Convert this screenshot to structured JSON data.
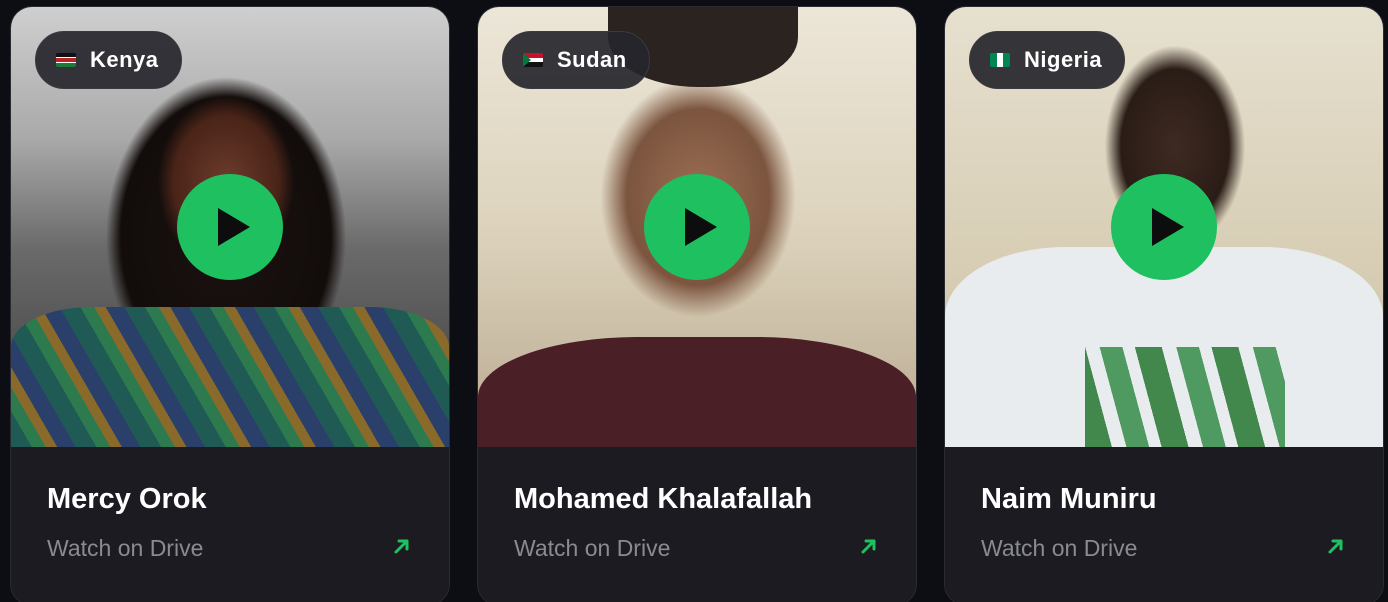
{
  "cards": [
    {
      "country": "Kenya",
      "flag_icon": "kenya-flag-icon",
      "name": "Mercy Orok",
      "link_label": "Watch on Drive"
    },
    {
      "country": "Sudan",
      "flag_icon": "sudan-flag-icon",
      "name": "Mohamed Khalafallah",
      "link_label": "Watch on Drive"
    },
    {
      "country": "Nigeria",
      "flag_icon": "nigeria-flag-icon",
      "name": "Naim Muniru",
      "link_label": "Watch on Drive"
    }
  ],
  "colors": {
    "accent": "#1fc05f",
    "card_bg": "#1b1b21",
    "page_bg": "#0d0d14",
    "muted_text": "#8a8a92"
  },
  "icons": {
    "play": "play-icon",
    "external_link": "arrow-up-right-icon"
  }
}
